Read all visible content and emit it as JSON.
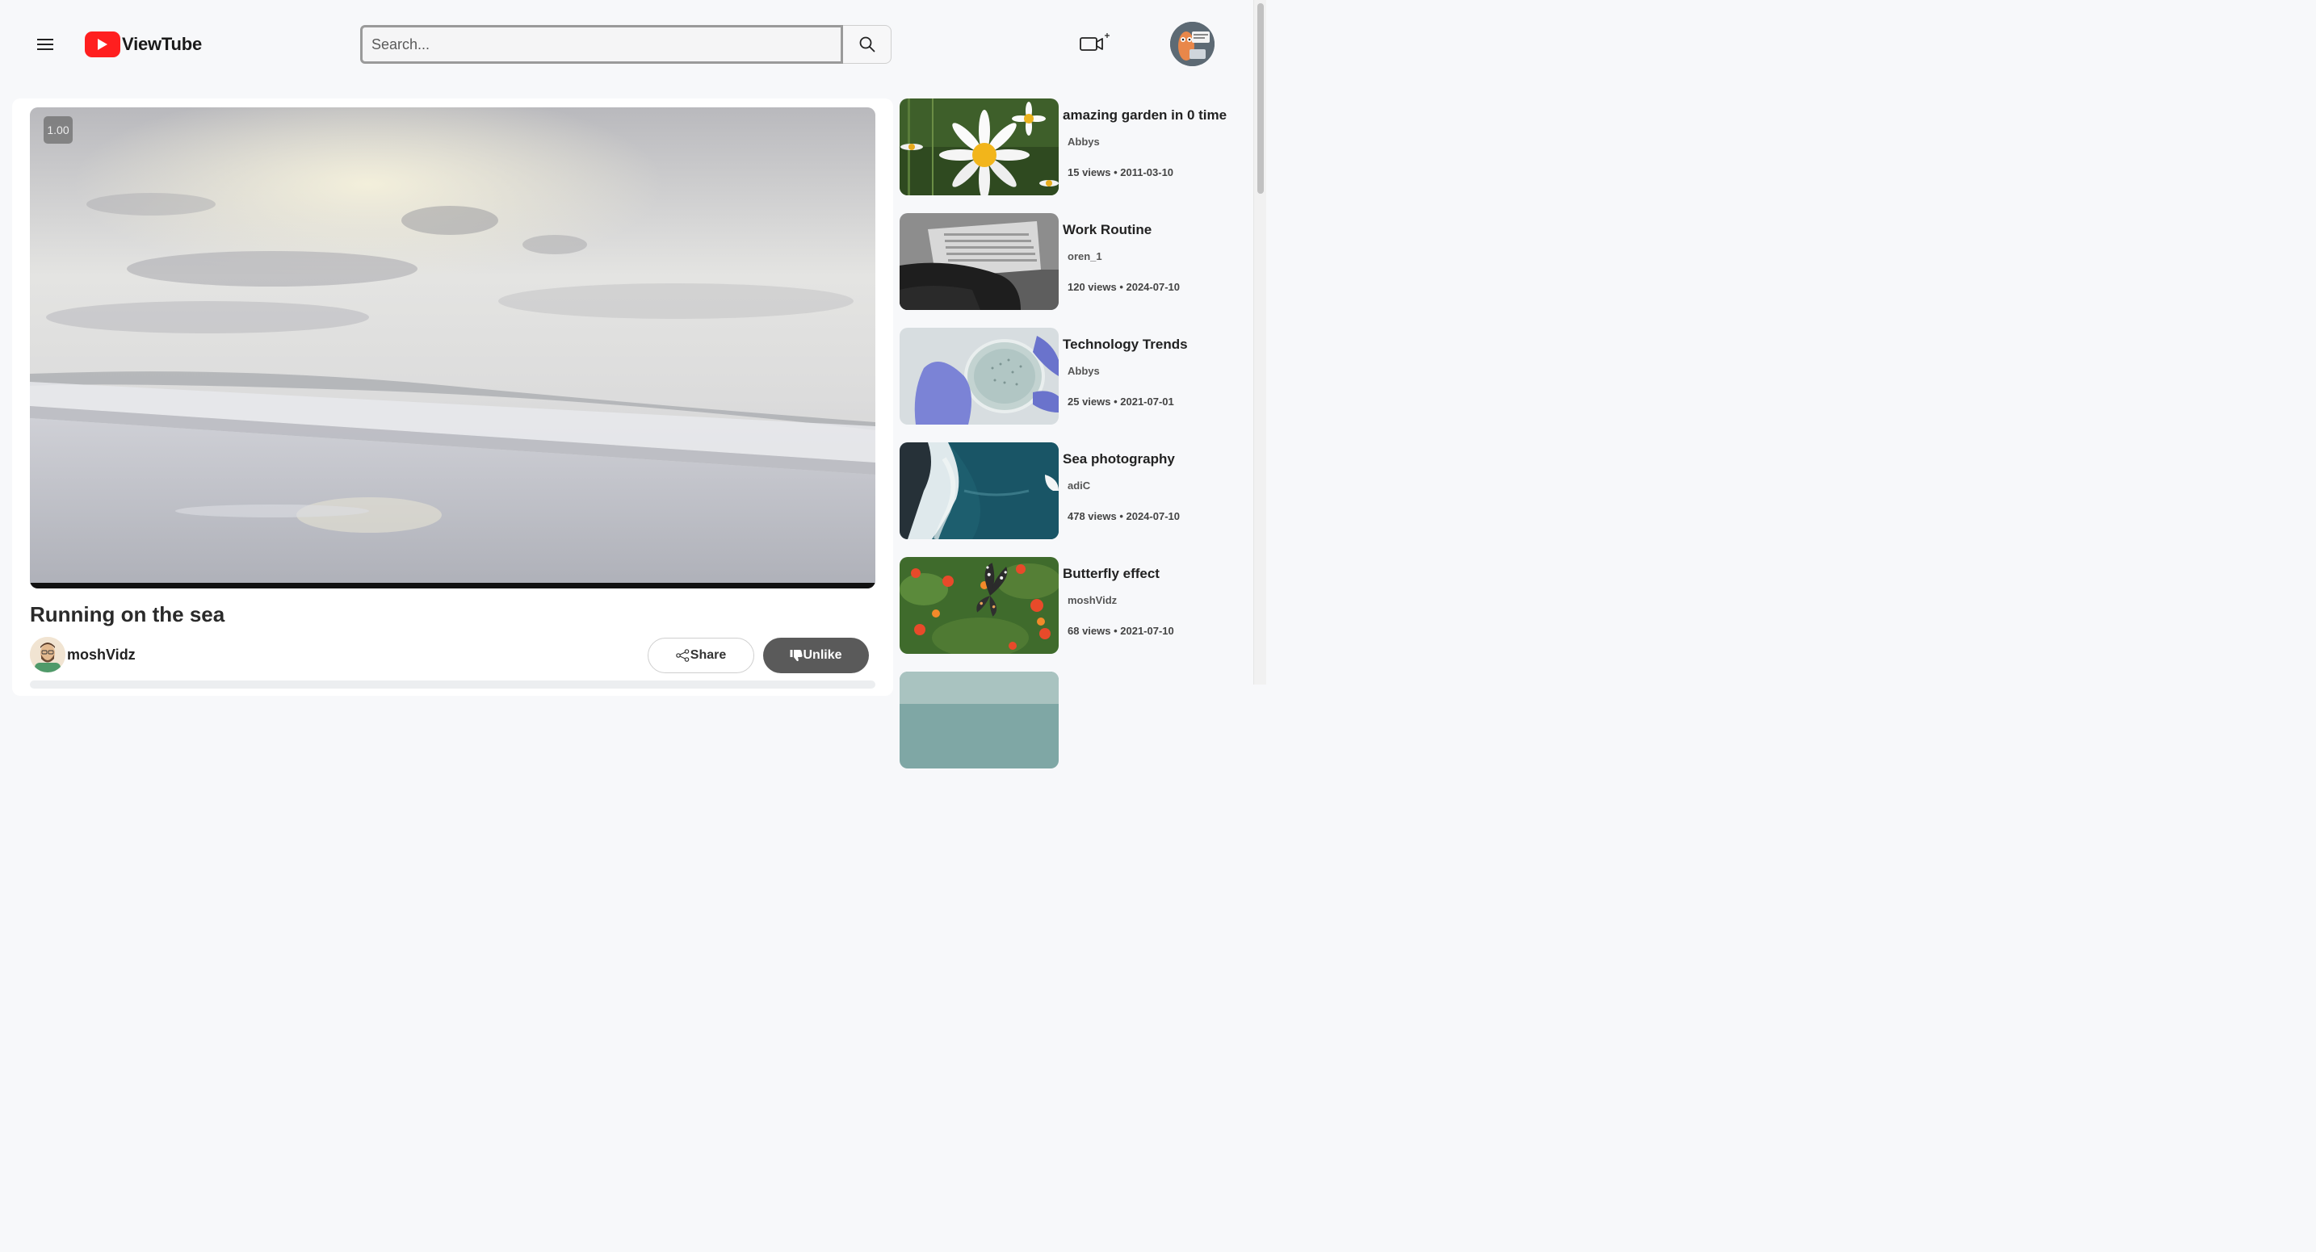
{
  "app": {
    "name": "ViewTube"
  },
  "search": {
    "placeholder": "Search..."
  },
  "icons": {
    "menu": "hamburger-icon",
    "logo": "play-icon",
    "search": "search-icon",
    "upload": "video-camera-plus-icon",
    "share": "share-icon",
    "unlike": "thumbs-down-icon"
  },
  "player": {
    "speed": "1.00"
  },
  "video": {
    "title": "Running on the sea",
    "channel": "moshVidz",
    "share_label": "Share",
    "unlike_label": "Unlike"
  },
  "colors": {
    "brand": "#ff1f1f",
    "unlike_button": "#5a5a5a",
    "background": "#f7f8fa"
  },
  "recommendations": [
    {
      "title": "amazing garden in 0 time",
      "channel": "Abbys",
      "meta": "15 views • 2011-03-10"
    },
    {
      "title": "Work Routine",
      "channel": "oren_1",
      "meta": "120 views • 2024-07-10"
    },
    {
      "title": "Technology Trends",
      "channel": "Abbys",
      "meta": "25 views • 2021-07-01"
    },
    {
      "title": "Sea photography",
      "channel": "adiC",
      "meta": "478 views • 2024-07-10"
    },
    {
      "title": "Butterfly effect",
      "channel": "moshVidz",
      "meta": "68 views • 2021-07-10"
    },
    {
      "title": "",
      "channel": "",
      "meta": ""
    }
  ]
}
